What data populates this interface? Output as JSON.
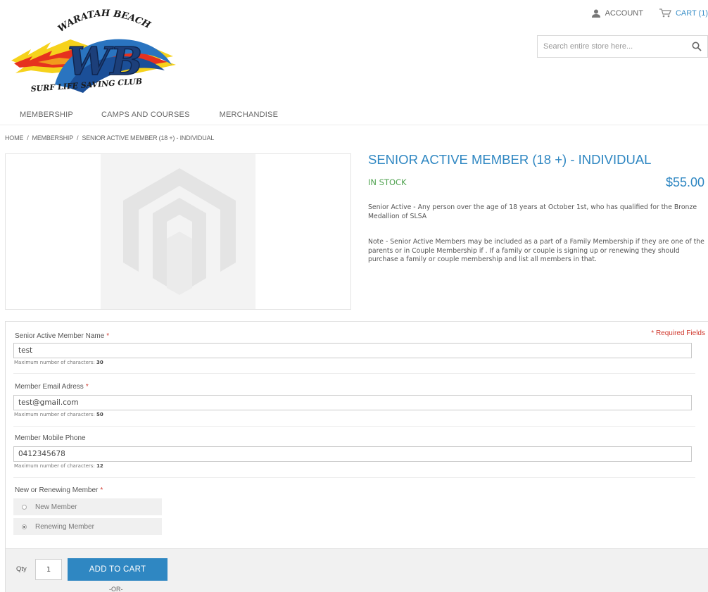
{
  "logo": {
    "top_text": "WARATAH BEACH",
    "initials": "WB",
    "bottom_text": "SURF LIFE SAVING CLUB"
  },
  "header": {
    "account_label": "ACCOUNT",
    "cart_label": "CART (1)",
    "search_placeholder": "Search entire store here..."
  },
  "nav": {
    "items": [
      "MEMBERSHIP",
      "CAMPS AND COURSES",
      "MERCHANDISE"
    ]
  },
  "breadcrumb": {
    "home": "HOME",
    "separator": "/",
    "membership": "MEMBERSHIP",
    "current": "SENIOR ACTIVE MEMBER (18 +) - INDIVIDUAL"
  },
  "product": {
    "title": "SENIOR ACTIVE MEMBER (18 +) - INDIVIDUAL",
    "stock_status": "IN STOCK",
    "price": "$55.00",
    "description_1": "Senior Active - Any person over the age of 18 years at October 1st, who has qualified for the Bronze Medallion of SLSA",
    "description_2": "Note - Senior Active Members may be included as a part of a Family Membership if they are one of the parents or in Couple Membership if . If a family or couple is signing up or renewing they should purchase a family or couple membership and list all members in that."
  },
  "form": {
    "required_note": "* Required Fields",
    "max_chars_label": "Maximum number of characters:",
    "fields": [
      {
        "label": "Senior Active Member Name",
        "required": "*",
        "value": "test",
        "max": "30"
      },
      {
        "label": "Member Email Adress",
        "required": "*",
        "value": "test@gmail.com",
        "max": "50"
      },
      {
        "label": "Member Mobile Phone",
        "required": "",
        "value": "0412345678",
        "max": "12"
      }
    ],
    "radio_group": {
      "label": "New or Renewing Member",
      "required": "*",
      "options": [
        "New Member",
        "Renewing Member"
      ],
      "selected": "Renewing Member"
    }
  },
  "cart": {
    "qty_label": "Qty",
    "qty_value": "1",
    "add_button": "ADD TO CART",
    "or_text": "-OR-"
  },
  "colors": {
    "brand_blue": "#2f87c2",
    "stock_green": "#52a352",
    "required_red": "#d03a2f"
  }
}
